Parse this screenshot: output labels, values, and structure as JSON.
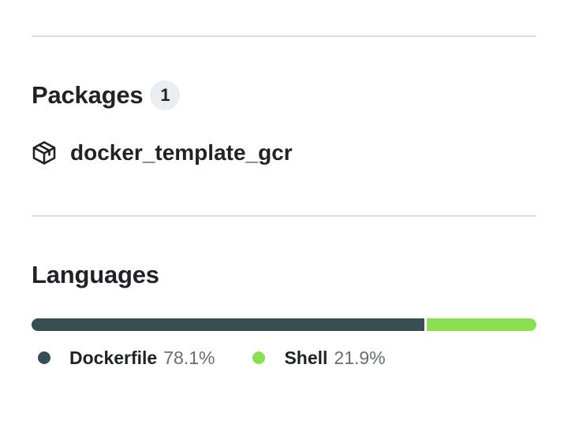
{
  "packages": {
    "title": "Packages",
    "count": "1",
    "items": [
      {
        "name": "docker_template_gcr",
        "icon": "package-icon"
      }
    ]
  },
  "languages": {
    "title": "Languages",
    "items": [
      {
        "name": "Dockerfile",
        "percent_label": "78.1%",
        "percent": 78.1,
        "color": "#384d54"
      },
      {
        "name": "Shell",
        "percent_label": "21.9%",
        "percent": 21.9,
        "color": "#89e051"
      }
    ]
  }
}
